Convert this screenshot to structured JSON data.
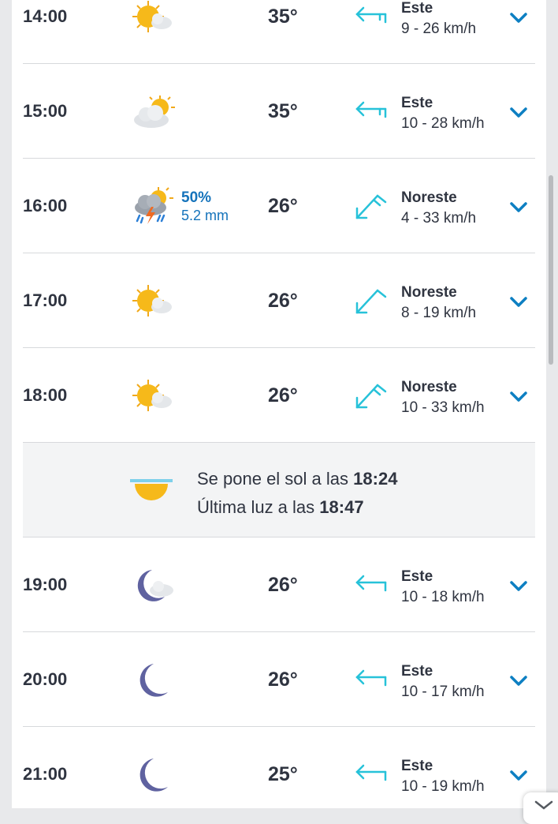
{
  "colors": {
    "accent": "#0d7fc2",
    "wind_arrow": "#27c2d9",
    "text": "#2f3440",
    "precip": "#1573bb",
    "sun": "#f6b91a",
    "moon": "#5f62a0"
  },
  "hours": [
    {
      "time": "14:00",
      "icon": "sun-cloud-icon",
      "temp": "35°",
      "wind_dir": "Este",
      "wind_speed": "9 - 26 km/h",
      "arrow": "wind-east-arrow-icon"
    },
    {
      "time": "15:00",
      "icon": "cloud-sun-icon",
      "temp": "35°",
      "wind_dir": "Este",
      "wind_speed": "10 - 28 km/h",
      "arrow": "wind-east-arrow-icon"
    },
    {
      "time": "16:00",
      "icon": "thunderstorm-icon",
      "precip_pct": "50%",
      "precip_mm": "5.2 mm",
      "temp": "26°",
      "wind_dir": "Noreste",
      "wind_speed": "4 - 33 km/h",
      "arrow": "wind-northeast-arrow-icon"
    },
    {
      "time": "17:00",
      "icon": "sun-cloud-icon",
      "temp": "26°",
      "wind_dir": "Noreste",
      "wind_speed": "8 - 19 km/h",
      "arrow": "wind-northeast-arrow-icon"
    },
    {
      "time": "18:00",
      "icon": "sun-cloud-icon",
      "temp": "26°",
      "wind_dir": "Noreste",
      "wind_speed": "10 - 33 km/h",
      "arrow": "wind-northeast-arrow-icon"
    },
    {
      "time": "19:00",
      "icon": "moon-cloud-icon",
      "temp": "26°",
      "wind_dir": "Este",
      "wind_speed": "10 - 18 km/h",
      "arrow": "wind-east-arrow-icon"
    },
    {
      "time": "20:00",
      "icon": "moon-icon",
      "temp": "26°",
      "wind_dir": "Este",
      "wind_speed": "10 - 17 km/h",
      "arrow": "wind-east-arrow-icon"
    },
    {
      "time": "21:00",
      "icon": "moon-icon",
      "temp": "25°",
      "wind_dir": "Este",
      "wind_speed": "10 - 19 km/h",
      "arrow": "wind-east-arrow-icon"
    }
  ],
  "sunset": {
    "line1_prefix": "Se pone el sol a las",
    "line1_time": "18:24",
    "line2_prefix": "Última luz a las",
    "line2_time": "18:47",
    "icon": "sunset-icon"
  }
}
